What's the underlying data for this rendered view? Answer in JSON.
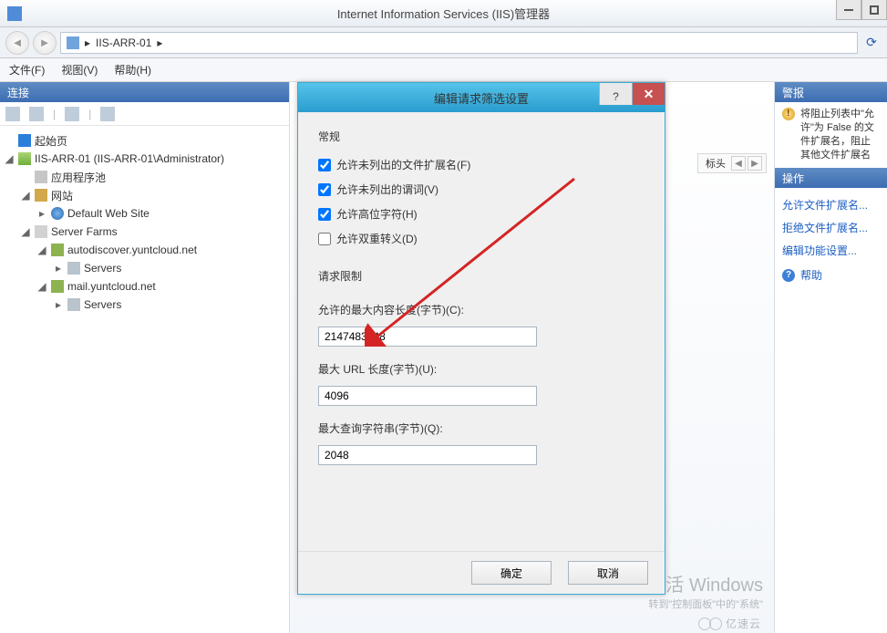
{
  "window": {
    "title": "Internet Information Services (IIS)管理器"
  },
  "breadcrumb": {
    "text": "IIS-ARR-01"
  },
  "menu": {
    "file": "文件(F)",
    "view": "视图(V)",
    "help": "帮助(H)"
  },
  "panes": {
    "connections_title": "连接",
    "center_toolstrip": "标头",
    "alerts_title": "警报",
    "alert_text": "将阻止列表中\"允许\"为 False 的文件扩展名，阻止其他文件扩展名",
    "actions_title": "操作",
    "actions": {
      "allow_ext": "允许文件扩展名...",
      "deny_ext": "拒绝文件扩展名...",
      "edit_feature": "编辑功能设置..."
    },
    "help": "帮助"
  },
  "tree": {
    "start": "起始页",
    "server": "IIS-ARR-01 (IIS-ARR-01\\Administrator)",
    "apppool": "应用程序池",
    "sites": "网站",
    "default_site": "Default Web Site",
    "server_farms": "Server Farms",
    "farm1": "autodiscover.yuntcloud.net",
    "servers1": "Servers",
    "farm2": "mail.yuntcloud.net",
    "servers2": "Servers"
  },
  "dialog": {
    "title": "编辑请求筛选设置",
    "group_general": "常规",
    "cb_ext": "允许未列出的文件扩展名(F)",
    "cb_verb": "允许未列出的谓词(V)",
    "cb_highbit": "允许高位字符(H)",
    "cb_double": "允许双重转义(D)",
    "group_limits": "请求限制",
    "lbl_maxcontent": "允许的最大内容长度(字节)(C):",
    "val_maxcontent": "2147483648",
    "lbl_maxurl": "最大 URL 长度(字节)(U):",
    "val_maxurl": "4096",
    "lbl_maxquery": "最大查询字符串(字节)(Q):",
    "val_maxquery": "2048",
    "ok": "确定",
    "cancel": "取消"
  },
  "watermark": {
    "line1": "激活 Windows",
    "line2": "转到\"控制面板\"中的\"系统\""
  },
  "brand": "亿速云"
}
